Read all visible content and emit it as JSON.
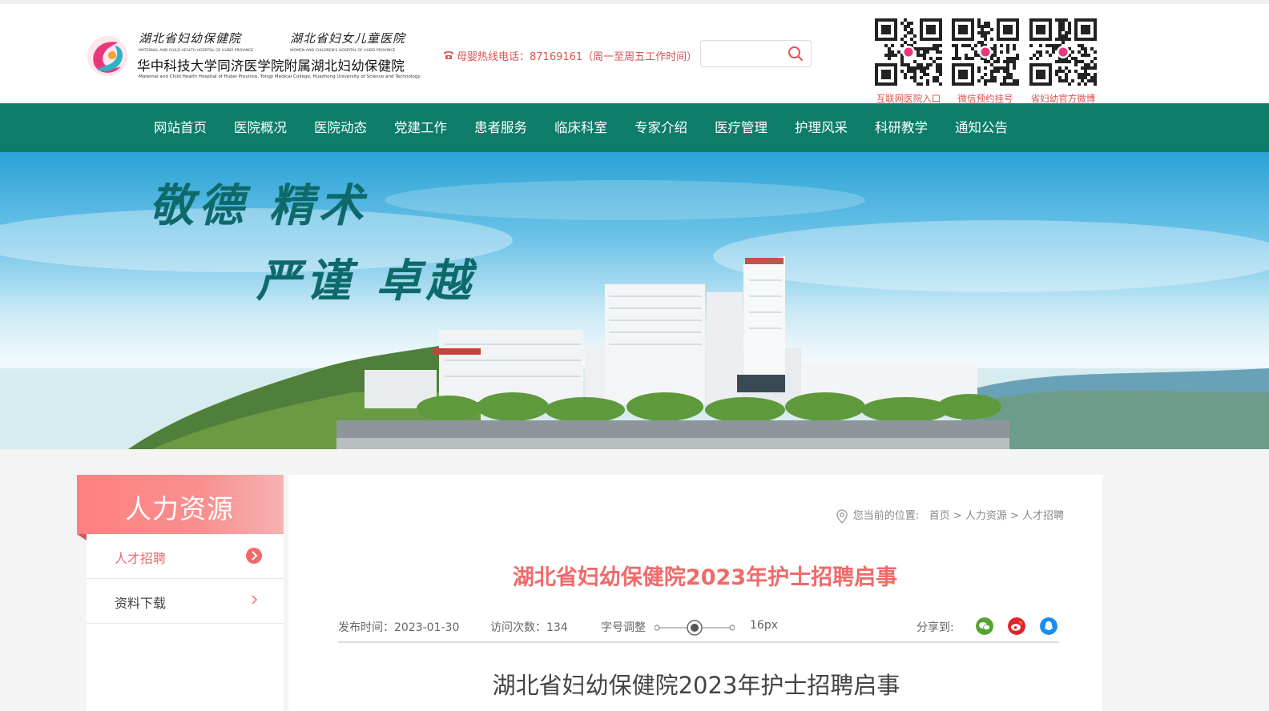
{
  "header": {
    "logo_calligraphy_1": "湖北省妇幼保健院",
    "logo_calligraphy_2": "湖北省妇女儿童医院",
    "logo_en_1": "MATERNAL AND CHILD HEALTH HOSPITAL OF HUBEI PROVINCE",
    "logo_en_2": "WOMEN AND CHILDREN'S HOSPITAL OF HUBEI PROVINCE",
    "logo_cn": "华中科技大学同济医学院附属湖北妇幼保健院",
    "logo_en_3": "Maternal and Child Health Hospital of Hubei Province, Tongji Medical College, Huazhong University of Science and Technology",
    "hotline": "母婴热线电话：87169161（周一至周五工作时间）",
    "search_placeholder": "",
    "qr_codes": [
      {
        "label": "互联网医院入口"
      },
      {
        "label": "微信预约挂号"
      },
      {
        "label": "省妇幼官方微博"
      }
    ]
  },
  "nav": {
    "items": [
      "网站首页",
      "医院概况",
      "医院动态",
      "党建工作",
      "患者服务",
      "临床科室",
      "专家介绍",
      "医疗管理",
      "护理风采",
      "科研教学",
      "通知公告"
    ]
  },
  "banner": {
    "slogan_line1": "敬德  精术",
    "slogan_line2": "严谨  卓越"
  },
  "sidebar": {
    "title": "人力资源",
    "items": [
      {
        "label": "人才招聘",
        "active": true
      },
      {
        "label": "资料下载",
        "active": false
      }
    ]
  },
  "breadcrumb": {
    "prefix": "您当前的位置:",
    "items": [
      "首页",
      "人力资源",
      "人才招聘"
    ],
    "separator": ">"
  },
  "article": {
    "title": "湖北省妇幼保健院2023年护士招聘启事",
    "publish_label": "发布时间：",
    "publish_date": "2023-01-30",
    "visits_label": "访问次数：",
    "visits": "134",
    "font_label": "字号调整",
    "font_size": "16px",
    "share_label": "分享到:",
    "body_title": "湖北省妇幼保健院2023年护士招聘启事"
  },
  "colors": {
    "nav_bg": "#0d7d6a",
    "accent_red": "#f06a6a",
    "sidebar_gradient_start": "#ff8080",
    "wechat": "#52a52e",
    "weibo": "#e0232c",
    "qq": "#1b8cf2"
  },
  "icons": {
    "search": "search-icon",
    "phone": "phone-icon",
    "location": "location-pin-icon",
    "arrow": "chevron-right-icon",
    "wechat": "wechat-icon",
    "weibo": "weibo-icon",
    "qq": "qq-icon"
  }
}
